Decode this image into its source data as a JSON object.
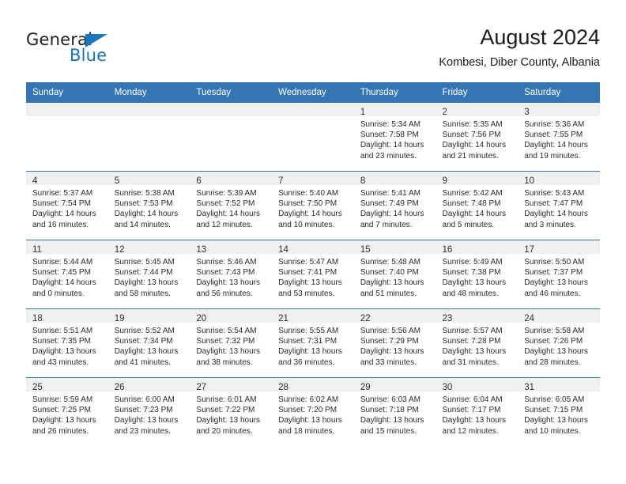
{
  "brand": {
    "word_one": "General",
    "word_two": "Blue",
    "triangle_icon": "triangle-icon"
  },
  "header": {
    "title": "August 2024",
    "subtitle": "Kombesi, Diber County, Albania"
  },
  "colors": {
    "header_blue": "#3575b4",
    "brand_blue": "#1b75bb",
    "daynum_band": "#f0f0f0",
    "text": "#2b2b2b"
  },
  "calendar": {
    "weekday_headers": [
      "Sunday",
      "Monday",
      "Tuesday",
      "Wednesday",
      "Thursday",
      "Friday",
      "Saturday"
    ],
    "weeks": [
      [
        {
          "day": "",
          "lines": []
        },
        {
          "day": "",
          "lines": []
        },
        {
          "day": "",
          "lines": []
        },
        {
          "day": "",
          "lines": []
        },
        {
          "day": "1",
          "lines": [
            "Sunrise: 5:34 AM",
            "Sunset: 7:58 PM",
            "Daylight: 14 hours",
            "and 23 minutes."
          ]
        },
        {
          "day": "2",
          "lines": [
            "Sunrise: 5:35 AM",
            "Sunset: 7:56 PM",
            "Daylight: 14 hours",
            "and 21 minutes."
          ]
        },
        {
          "day": "3",
          "lines": [
            "Sunrise: 5:36 AM",
            "Sunset: 7:55 PM",
            "Daylight: 14 hours",
            "and 19 minutes."
          ]
        }
      ],
      [
        {
          "day": "4",
          "lines": [
            "Sunrise: 5:37 AM",
            "Sunset: 7:54 PM",
            "Daylight: 14 hours",
            "and 16 minutes."
          ]
        },
        {
          "day": "5",
          "lines": [
            "Sunrise: 5:38 AM",
            "Sunset: 7:53 PM",
            "Daylight: 14 hours",
            "and 14 minutes."
          ]
        },
        {
          "day": "6",
          "lines": [
            "Sunrise: 5:39 AM",
            "Sunset: 7:52 PM",
            "Daylight: 14 hours",
            "and 12 minutes."
          ]
        },
        {
          "day": "7",
          "lines": [
            "Sunrise: 5:40 AM",
            "Sunset: 7:50 PM",
            "Daylight: 14 hours",
            "and 10 minutes."
          ]
        },
        {
          "day": "8",
          "lines": [
            "Sunrise: 5:41 AM",
            "Sunset: 7:49 PM",
            "Daylight: 14 hours",
            "and 7 minutes."
          ]
        },
        {
          "day": "9",
          "lines": [
            "Sunrise: 5:42 AM",
            "Sunset: 7:48 PM",
            "Daylight: 14 hours",
            "and 5 minutes."
          ]
        },
        {
          "day": "10",
          "lines": [
            "Sunrise: 5:43 AM",
            "Sunset: 7:47 PM",
            "Daylight: 14 hours",
            "and 3 minutes."
          ]
        }
      ],
      [
        {
          "day": "11",
          "lines": [
            "Sunrise: 5:44 AM",
            "Sunset: 7:45 PM",
            "Daylight: 14 hours",
            "and 0 minutes."
          ]
        },
        {
          "day": "12",
          "lines": [
            "Sunrise: 5:45 AM",
            "Sunset: 7:44 PM",
            "Daylight: 13 hours",
            "and 58 minutes."
          ]
        },
        {
          "day": "13",
          "lines": [
            "Sunrise: 5:46 AM",
            "Sunset: 7:43 PM",
            "Daylight: 13 hours",
            "and 56 minutes."
          ]
        },
        {
          "day": "14",
          "lines": [
            "Sunrise: 5:47 AM",
            "Sunset: 7:41 PM",
            "Daylight: 13 hours",
            "and 53 minutes."
          ]
        },
        {
          "day": "15",
          "lines": [
            "Sunrise: 5:48 AM",
            "Sunset: 7:40 PM",
            "Daylight: 13 hours",
            "and 51 minutes."
          ]
        },
        {
          "day": "16",
          "lines": [
            "Sunrise: 5:49 AM",
            "Sunset: 7:38 PM",
            "Daylight: 13 hours",
            "and 48 minutes."
          ]
        },
        {
          "day": "17",
          "lines": [
            "Sunrise: 5:50 AM",
            "Sunset: 7:37 PM",
            "Daylight: 13 hours",
            "and 46 minutes."
          ]
        }
      ],
      [
        {
          "day": "18",
          "lines": [
            "Sunrise: 5:51 AM",
            "Sunset: 7:35 PM",
            "Daylight: 13 hours",
            "and 43 minutes."
          ]
        },
        {
          "day": "19",
          "lines": [
            "Sunrise: 5:52 AM",
            "Sunset: 7:34 PM",
            "Daylight: 13 hours",
            "and 41 minutes."
          ]
        },
        {
          "day": "20",
          "lines": [
            "Sunrise: 5:54 AM",
            "Sunset: 7:32 PM",
            "Daylight: 13 hours",
            "and 38 minutes."
          ]
        },
        {
          "day": "21",
          "lines": [
            "Sunrise: 5:55 AM",
            "Sunset: 7:31 PM",
            "Daylight: 13 hours",
            "and 36 minutes."
          ]
        },
        {
          "day": "22",
          "lines": [
            "Sunrise: 5:56 AM",
            "Sunset: 7:29 PM",
            "Daylight: 13 hours",
            "and 33 minutes."
          ]
        },
        {
          "day": "23",
          "lines": [
            "Sunrise: 5:57 AM",
            "Sunset: 7:28 PM",
            "Daylight: 13 hours",
            "and 31 minutes."
          ]
        },
        {
          "day": "24",
          "lines": [
            "Sunrise: 5:58 AM",
            "Sunset: 7:26 PM",
            "Daylight: 13 hours",
            "and 28 minutes."
          ]
        }
      ],
      [
        {
          "day": "25",
          "lines": [
            "Sunrise: 5:59 AM",
            "Sunset: 7:25 PM",
            "Daylight: 13 hours",
            "and 26 minutes."
          ]
        },
        {
          "day": "26",
          "lines": [
            "Sunrise: 6:00 AM",
            "Sunset: 7:23 PM",
            "Daylight: 13 hours",
            "and 23 minutes."
          ]
        },
        {
          "day": "27",
          "lines": [
            "Sunrise: 6:01 AM",
            "Sunset: 7:22 PM",
            "Daylight: 13 hours",
            "and 20 minutes."
          ]
        },
        {
          "day": "28",
          "lines": [
            "Sunrise: 6:02 AM",
            "Sunset: 7:20 PM",
            "Daylight: 13 hours",
            "and 18 minutes."
          ]
        },
        {
          "day": "29",
          "lines": [
            "Sunrise: 6:03 AM",
            "Sunset: 7:18 PM",
            "Daylight: 13 hours",
            "and 15 minutes."
          ]
        },
        {
          "day": "30",
          "lines": [
            "Sunrise: 6:04 AM",
            "Sunset: 7:17 PM",
            "Daylight: 13 hours",
            "and 12 minutes."
          ]
        },
        {
          "day": "31",
          "lines": [
            "Sunrise: 6:05 AM",
            "Sunset: 7:15 PM",
            "Daylight: 13 hours",
            "and 10 minutes."
          ]
        }
      ]
    ]
  }
}
